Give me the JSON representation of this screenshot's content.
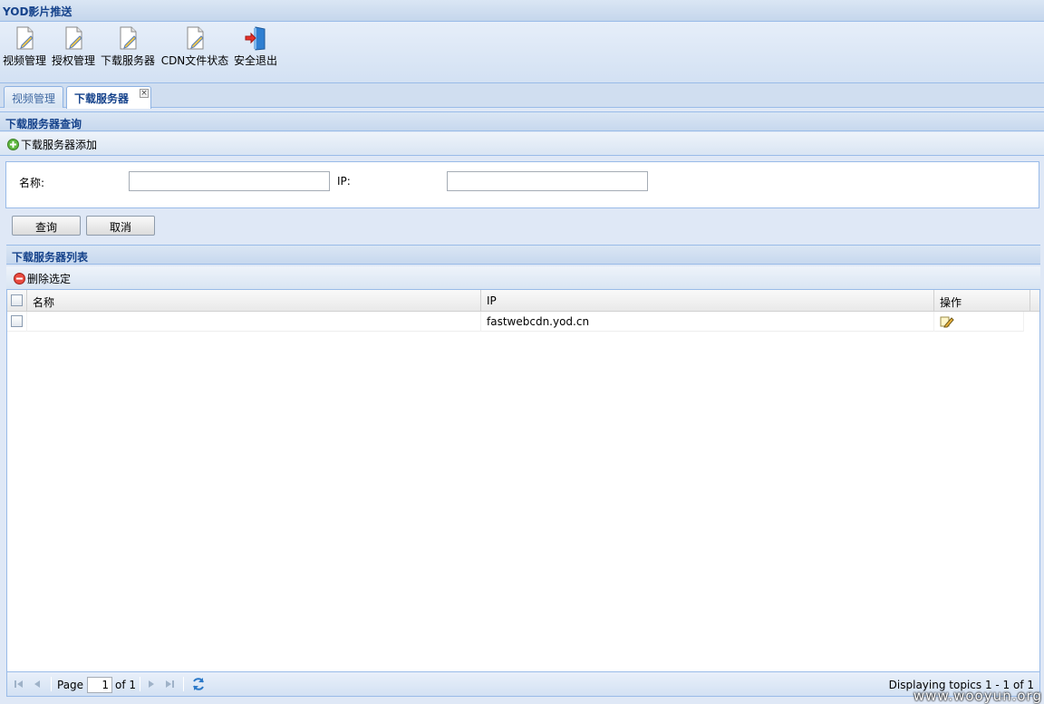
{
  "app": {
    "title": "YOD影片推送"
  },
  "toolbar": {
    "items": [
      {
        "label": "视频管理",
        "icon": "document-edit-icon"
      },
      {
        "label": "授权管理",
        "icon": "document-edit-icon"
      },
      {
        "label": "下载服务器",
        "icon": "document-edit-icon"
      },
      {
        "label": "CDN文件状态",
        "icon": "document-edit-icon"
      },
      {
        "label": "安全退出",
        "icon": "logout-door-icon"
      }
    ]
  },
  "tabs": [
    {
      "label": "视频管理",
      "active": false
    },
    {
      "label": "下载服务器",
      "active": true,
      "closable": true
    }
  ],
  "query_panel": {
    "title": "下载服务器查询",
    "add_label": "下载服务器添加",
    "fields": {
      "name_label": "名称:",
      "name_value": "",
      "ip_label": "IP:",
      "ip_value": ""
    },
    "search_button": "查询",
    "cancel_button": "取消"
  },
  "list_panel": {
    "title": "下载服务器列表",
    "delete_label": "删除选定",
    "columns": [
      "名称",
      "IP",
      "操作"
    ],
    "rows": [
      {
        "name": "",
        "ip": "fastwebcdn.yod.cn",
        "action_icon": "edit-pencil-icon"
      }
    ]
  },
  "pager": {
    "page_label": "Page",
    "page_value": "1",
    "of_label": "of 1",
    "display_text": "Displaying topics 1 - 1 of 1"
  },
  "watermark": "www.wooyun.org",
  "colors": {
    "header_text": "#15428b",
    "border": "#99bbe8"
  }
}
